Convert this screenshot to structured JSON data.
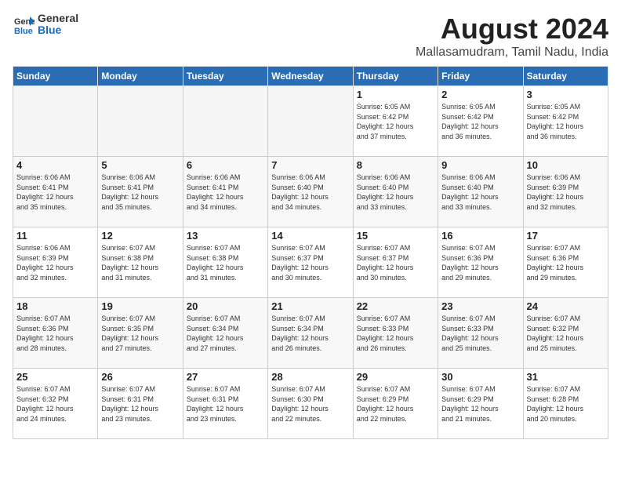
{
  "header": {
    "logo_general": "General",
    "logo_blue": "Blue",
    "title": "August 2024",
    "subtitle": "Mallasamudram, Tamil Nadu, India"
  },
  "days_of_week": [
    "Sunday",
    "Monday",
    "Tuesday",
    "Wednesday",
    "Thursday",
    "Friday",
    "Saturday"
  ],
  "weeks": [
    [
      {
        "day": "",
        "info": ""
      },
      {
        "day": "",
        "info": ""
      },
      {
        "day": "",
        "info": ""
      },
      {
        "day": "",
        "info": ""
      },
      {
        "day": "1",
        "info": "Sunrise: 6:05 AM\nSunset: 6:42 PM\nDaylight: 12 hours\nand 37 minutes."
      },
      {
        "day": "2",
        "info": "Sunrise: 6:05 AM\nSunset: 6:42 PM\nDaylight: 12 hours\nand 36 minutes."
      },
      {
        "day": "3",
        "info": "Sunrise: 6:05 AM\nSunset: 6:42 PM\nDaylight: 12 hours\nand 36 minutes."
      }
    ],
    [
      {
        "day": "4",
        "info": "Sunrise: 6:06 AM\nSunset: 6:41 PM\nDaylight: 12 hours\nand 35 minutes."
      },
      {
        "day": "5",
        "info": "Sunrise: 6:06 AM\nSunset: 6:41 PM\nDaylight: 12 hours\nand 35 minutes."
      },
      {
        "day": "6",
        "info": "Sunrise: 6:06 AM\nSunset: 6:41 PM\nDaylight: 12 hours\nand 34 minutes."
      },
      {
        "day": "7",
        "info": "Sunrise: 6:06 AM\nSunset: 6:40 PM\nDaylight: 12 hours\nand 34 minutes."
      },
      {
        "day": "8",
        "info": "Sunrise: 6:06 AM\nSunset: 6:40 PM\nDaylight: 12 hours\nand 33 minutes."
      },
      {
        "day": "9",
        "info": "Sunrise: 6:06 AM\nSunset: 6:40 PM\nDaylight: 12 hours\nand 33 minutes."
      },
      {
        "day": "10",
        "info": "Sunrise: 6:06 AM\nSunset: 6:39 PM\nDaylight: 12 hours\nand 32 minutes."
      }
    ],
    [
      {
        "day": "11",
        "info": "Sunrise: 6:06 AM\nSunset: 6:39 PM\nDaylight: 12 hours\nand 32 minutes."
      },
      {
        "day": "12",
        "info": "Sunrise: 6:07 AM\nSunset: 6:38 PM\nDaylight: 12 hours\nand 31 minutes."
      },
      {
        "day": "13",
        "info": "Sunrise: 6:07 AM\nSunset: 6:38 PM\nDaylight: 12 hours\nand 31 minutes."
      },
      {
        "day": "14",
        "info": "Sunrise: 6:07 AM\nSunset: 6:37 PM\nDaylight: 12 hours\nand 30 minutes."
      },
      {
        "day": "15",
        "info": "Sunrise: 6:07 AM\nSunset: 6:37 PM\nDaylight: 12 hours\nand 30 minutes."
      },
      {
        "day": "16",
        "info": "Sunrise: 6:07 AM\nSunset: 6:36 PM\nDaylight: 12 hours\nand 29 minutes."
      },
      {
        "day": "17",
        "info": "Sunrise: 6:07 AM\nSunset: 6:36 PM\nDaylight: 12 hours\nand 29 minutes."
      }
    ],
    [
      {
        "day": "18",
        "info": "Sunrise: 6:07 AM\nSunset: 6:36 PM\nDaylight: 12 hours\nand 28 minutes."
      },
      {
        "day": "19",
        "info": "Sunrise: 6:07 AM\nSunset: 6:35 PM\nDaylight: 12 hours\nand 27 minutes."
      },
      {
        "day": "20",
        "info": "Sunrise: 6:07 AM\nSunset: 6:34 PM\nDaylight: 12 hours\nand 27 minutes."
      },
      {
        "day": "21",
        "info": "Sunrise: 6:07 AM\nSunset: 6:34 PM\nDaylight: 12 hours\nand 26 minutes."
      },
      {
        "day": "22",
        "info": "Sunrise: 6:07 AM\nSunset: 6:33 PM\nDaylight: 12 hours\nand 26 minutes."
      },
      {
        "day": "23",
        "info": "Sunrise: 6:07 AM\nSunset: 6:33 PM\nDaylight: 12 hours\nand 25 minutes."
      },
      {
        "day": "24",
        "info": "Sunrise: 6:07 AM\nSunset: 6:32 PM\nDaylight: 12 hours\nand 25 minutes."
      }
    ],
    [
      {
        "day": "25",
        "info": "Sunrise: 6:07 AM\nSunset: 6:32 PM\nDaylight: 12 hours\nand 24 minutes."
      },
      {
        "day": "26",
        "info": "Sunrise: 6:07 AM\nSunset: 6:31 PM\nDaylight: 12 hours\nand 23 minutes."
      },
      {
        "day": "27",
        "info": "Sunrise: 6:07 AM\nSunset: 6:31 PM\nDaylight: 12 hours\nand 23 minutes."
      },
      {
        "day": "28",
        "info": "Sunrise: 6:07 AM\nSunset: 6:30 PM\nDaylight: 12 hours\nand 22 minutes."
      },
      {
        "day": "29",
        "info": "Sunrise: 6:07 AM\nSunset: 6:29 PM\nDaylight: 12 hours\nand 22 minutes."
      },
      {
        "day": "30",
        "info": "Sunrise: 6:07 AM\nSunset: 6:29 PM\nDaylight: 12 hours\nand 21 minutes."
      },
      {
        "day": "31",
        "info": "Sunrise: 6:07 AM\nSunset: 6:28 PM\nDaylight: 12 hours\nand 20 minutes."
      }
    ]
  ]
}
